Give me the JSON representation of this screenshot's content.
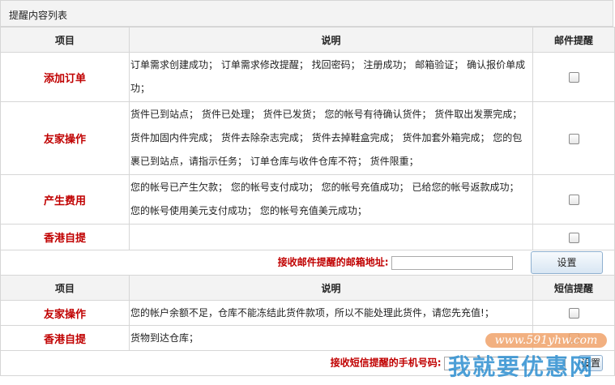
{
  "title": "提醒内容列表",
  "email_table": {
    "headers": [
      "项目",
      "说明",
      "邮件提醒"
    ],
    "rows": [
      {
        "item": "添加订单",
        "desc": "订单需求创建成功；  订单需求修改提醒；  找回密码；  注册成功；  邮箱验证；  确认报价单成功；"
      },
      {
        "item": "友家操作",
        "desc": "货件已到站点；  货件已处理；  货件已发货；  您的帐号有待确认货件；  货件取出发票完成；  货件加固内件完成；  货件去除杂志完成；  货件去掉鞋盒完成；  货件加套外箱完成；  您的包裹已到站点，请指示任务；  订单仓库与收件仓库不符；  货件限重；"
      },
      {
        "item": "产生费用",
        "desc": "您的帐号已产生欠款；  您的帐号支付成功；  您的帐号充值成功；  已给您的帐号返款成功；  您的帐号使用美元支付成功；  您的帐号充值美元成功；"
      },
      {
        "item": "香港自提",
        "desc": ""
      }
    ],
    "footer_label": "接收邮件提醒的邮箱地址:",
    "footer_value": "",
    "button": "设置"
  },
  "sms_table": {
    "headers": [
      "项目",
      "说明",
      "短信提醒"
    ],
    "rows": [
      {
        "item": "友家操作",
        "desc": "您的帐户余额不足，仓库不能冻结此货件款项，所以不能处理此货件，请您先充值!；"
      },
      {
        "item": "香港自提",
        "desc": "货物到达仓库；"
      }
    ],
    "footer_label": "接收短信提醒的手机号码:",
    "footer_value": "",
    "button": "设置"
  },
  "watermark": {
    "url": "www.591yhw.com",
    "text": "我就要优惠网"
  }
}
